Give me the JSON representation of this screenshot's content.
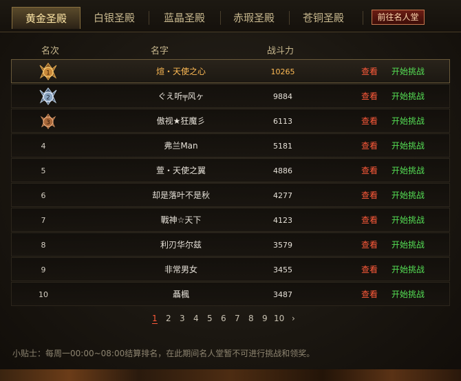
{
  "tabs": [
    {
      "label": "黄金圣殿",
      "active": true
    },
    {
      "label": "白银圣殿",
      "active": false
    },
    {
      "label": "蓝晶圣殿",
      "active": false
    },
    {
      "label": "赤瑕圣殿",
      "active": false
    },
    {
      "label": "苍铜圣殿",
      "active": false
    }
  ],
  "hall_button": "前往名人堂",
  "columns": {
    "rank": "名次",
    "name": "名字",
    "power": "战斗力"
  },
  "rows": [
    {
      "rank": "1",
      "name": "煊・天使之心",
      "power": "10265",
      "view": "查看",
      "challenge": "开始挑战"
    },
    {
      "rank": "2",
      "name": "ぐえ听╤风ヶ",
      "power": "9884",
      "view": "查看",
      "challenge": "开始挑战"
    },
    {
      "rank": "3",
      "name": "傲视★狂魔彡",
      "power": "6113",
      "view": "查看",
      "challenge": "开始挑战"
    },
    {
      "rank": "4",
      "name": "弗兰Man",
      "power": "5181",
      "view": "查看",
      "challenge": "开始挑战"
    },
    {
      "rank": "5",
      "name": "萱・天使之翼",
      "power": "4886",
      "view": "查看",
      "challenge": "开始挑战"
    },
    {
      "rank": "6",
      "name": "却是落叶不是秋",
      "power": "4277",
      "view": "查看",
      "challenge": "开始挑战"
    },
    {
      "rank": "7",
      "name": "戰神☆天下",
      "power": "4123",
      "view": "查看",
      "challenge": "开始挑战"
    },
    {
      "rank": "8",
      "name": "利刃华尔兹",
      "power": "3579",
      "view": "查看",
      "challenge": "开始挑战"
    },
    {
      "rank": "9",
      "name": "非常男女",
      "power": "3455",
      "view": "查看",
      "challenge": "开始挑战"
    },
    {
      "rank": "10",
      "name": "聶楓",
      "power": "3487",
      "view": "查看",
      "challenge": "开始挑战"
    }
  ],
  "pagination": {
    "pages": [
      "1",
      "2",
      "3",
      "4",
      "5",
      "6",
      "7",
      "8",
      "9",
      "10"
    ],
    "current": "1",
    "next": "›"
  },
  "tip": "小贴士：每周一00:00~08:00结算排名，在此期间名人堂暂不可进行挑战和领奖。",
  "colors": {
    "gold_text": "#ffbb55",
    "view_link": "#ff5a3a",
    "challenge_link": "#55e055",
    "medal_gold": "#c8893a",
    "medal_silver": "#8aa4c0",
    "medal_bronze": "#a8683a"
  }
}
